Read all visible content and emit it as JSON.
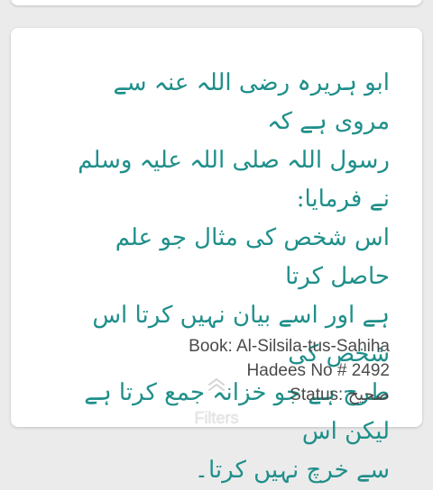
{
  "hadith": {
    "text": "ابو ہریرہ  رضی اللہ عنہ سے مروی ہے کہ\nرسول اللہ صلی اللہ علیہ وسلم نے فرمایا:\nاس شخص کی مثال جو علم حاصل کرتا\nہے اور اسے بیان نہیں کرتا اس شخص کی\nطرح ہے جو خزانہ جمع کرتا ہے لیکن اس\nسے خرچ نہیں کرتا۔"
  },
  "meta": {
    "book": "Book: Al-Silsila-tus-Sahiha",
    "hadees_no": "Hadees No # 2492",
    "status": "Status: صحیح"
  },
  "filters": {
    "label": "Filters",
    "icon": "double-chevron-up-icon"
  },
  "colors": {
    "urdu_text": "#1f8f8a",
    "meta_text": "#4a4a4a",
    "background": "#ebebeb",
    "card": "#ffffff"
  }
}
